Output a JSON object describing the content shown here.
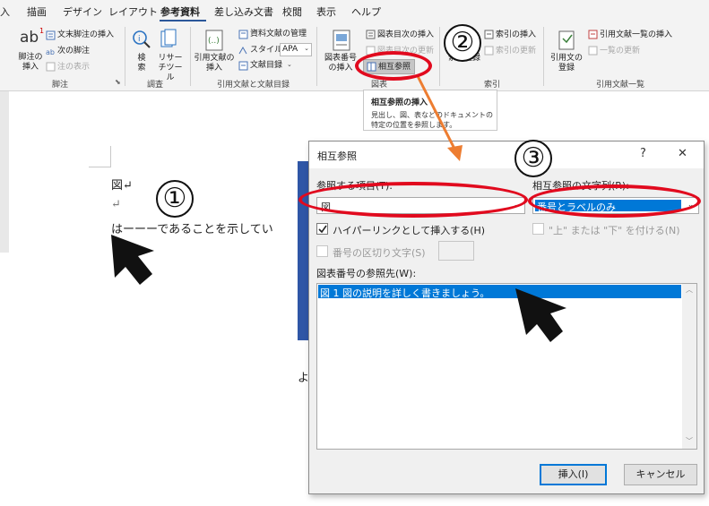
{
  "ribbon": {
    "tabs": [
      "入",
      "描画",
      "デザイン",
      "レイアウト",
      "参考資料",
      "差し込み文書",
      "校閲",
      "表示",
      "ヘルプ"
    ],
    "footnote": {
      "ab_glyph": "ab",
      "superscript": "1",
      "insert_label": "脚注の挿入",
      "endnote_label": "文末脚注の挿入",
      "next_label": "次の脚注",
      "show_label": "注の表示",
      "group": "脚注"
    },
    "research": {
      "search_label": "検索",
      "researcher_label": "リサーチツール",
      "group": "調査"
    },
    "citations": {
      "insert_label": "引用文献の挿入",
      "manage_label": "資料文献の管理",
      "style_label": "スタイル:",
      "style_value": "APA",
      "bibliography_label": "文献目録",
      "group": "引用文献と文献目録"
    },
    "captions": {
      "insert_label": "図表番号の挿入",
      "insert_tof_label": "図表目次の挿入",
      "update_label": "図表目次の更新",
      "cross_ref_label": "相互参照",
      "group": "図表"
    },
    "index": {
      "mark_label": "索引登録",
      "insert_label": "索引の挿入",
      "update_label": "索引の更新",
      "group": "索引"
    },
    "toa": {
      "mark_label": "引用文の登録",
      "insert_label": "引用文献一覧の挿入",
      "update_label": "一覧の更新",
      "group": "引用文献一覧"
    }
  },
  "tooltip": {
    "title": "相互参照の挿入",
    "line1": "見出し、図、表などのドキュメントの",
    "line2": "特定の位置を参照します。"
  },
  "document": {
    "line1": "図↵",
    "line2": "↵",
    "line3": "はーーーであることを示してい",
    "fragment": "よ"
  },
  "dialog": {
    "title": "相互参照",
    "help": "?",
    "close": "✕",
    "ref_type_label": "参照する項目(T):",
    "ref_type_value": "図",
    "insert_ref_label": "相互参照の文字列(R):",
    "insert_ref_value": "番号とラベルのみ",
    "hyperlink_label": "ハイパーリンクとして挿入する(H)",
    "separator_label": "番号の区切り文字(S)",
    "above_below_label": "\"上\" または \"下\" を付ける(N)",
    "for_which_label": "図表番号の参照先(W):",
    "items": [
      "図 1  図の説明を詳しく書きましょう。"
    ],
    "insert_button": "挿入(I)",
    "cancel_button": "キャンセル"
  },
  "annotations": {
    "marker1": "①",
    "marker2": "②",
    "marker3": "③"
  },
  "colors": {
    "accent_red": "#e10a1e",
    "selection_blue": "#0078d7",
    "arrow_orange": "#ed7d31"
  }
}
